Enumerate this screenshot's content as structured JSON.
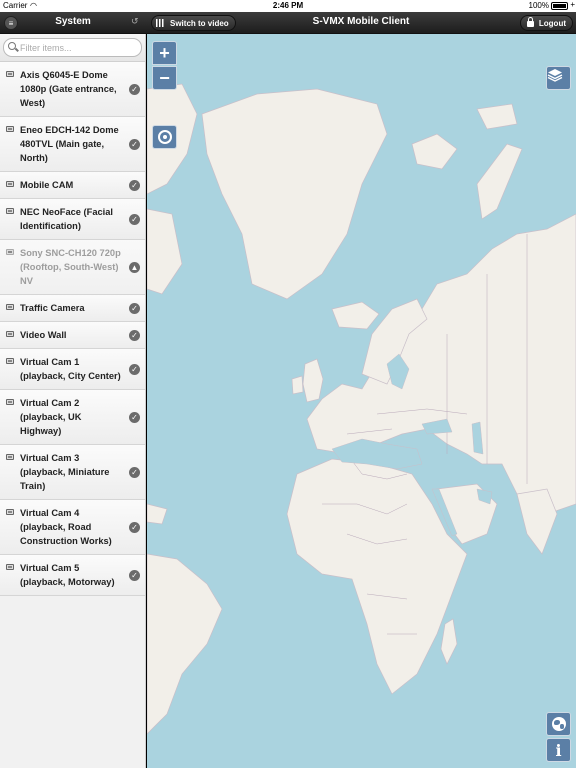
{
  "status_bar": {
    "carrier": "Carrier",
    "time": "2:46 PM",
    "battery": "100%"
  },
  "toolbar": {
    "system_title": "System",
    "switch_label": "Switch to video",
    "app_title": "S-VMX Mobile Client",
    "logout_label": "Logout"
  },
  "search": {
    "placeholder": "Filter items..."
  },
  "cameras": [
    {
      "label": "Axis Q6045-E Dome 1080p (Gate entrance, West)",
      "status": "ok"
    },
    {
      "label": "Eneo EDCH-142 Dome 480TVL (Main gate, North)",
      "status": "ok"
    },
    {
      "label": "Mobile CAM",
      "status": "ok"
    },
    {
      "label": "NEC NeoFace (Facial Identification)",
      "status": "ok"
    },
    {
      "label": "Sony SNC-CH120 720p (Rooftop, South-West) NV",
      "status": "warning"
    },
    {
      "label": "Traffic Camera",
      "status": "ok"
    },
    {
      "label": "Video Wall",
      "status": "ok"
    },
    {
      "label": "Virtual Cam 1 (playback, City Center)",
      "status": "ok"
    },
    {
      "label": "Virtual Cam 2 (playback, UK Highway)",
      "status": "ok"
    },
    {
      "label": "Virtual Cam 3 (playback, Miniature Train)",
      "status": "ok"
    },
    {
      "label": "Virtual Cam 4 (playback, Road Construction Works)",
      "status": "ok"
    },
    {
      "label": "Virtual Cam 5 (playback, Motorway)",
      "status": "ok"
    }
  ],
  "map": {
    "zoom_in": "+",
    "zoom_out": "−",
    "info": "i"
  },
  "colors": {
    "sea": "#aad3df",
    "land": "#f2efe9",
    "ice": "#f2efe9",
    "border": "#b9a8b9",
    "map_button": "#5b7fa6",
    "toolbar": "#2a2a2a"
  }
}
